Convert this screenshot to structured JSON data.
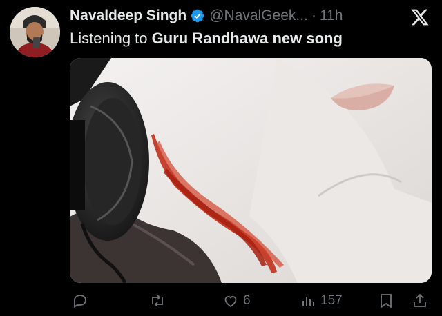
{
  "tweet": {
    "author_name": "Navaldeep Singh",
    "handle": "@NavalGeek...",
    "separator": "·",
    "time": "11h",
    "text_plain": "Listening to ",
    "text_bold": "Guru Randhawa new song",
    "verified_color": "#1d9bf0"
  },
  "media": {
    "icon": "headphones-photo"
  },
  "actions": {
    "reply_count": "",
    "retweet_count": "",
    "like_count": "6",
    "views_count": "157"
  },
  "colors": {
    "background": "#000000",
    "text_primary": "#e7e9ea",
    "text_secondary": "#71767b",
    "blood": "#c0301b"
  }
}
